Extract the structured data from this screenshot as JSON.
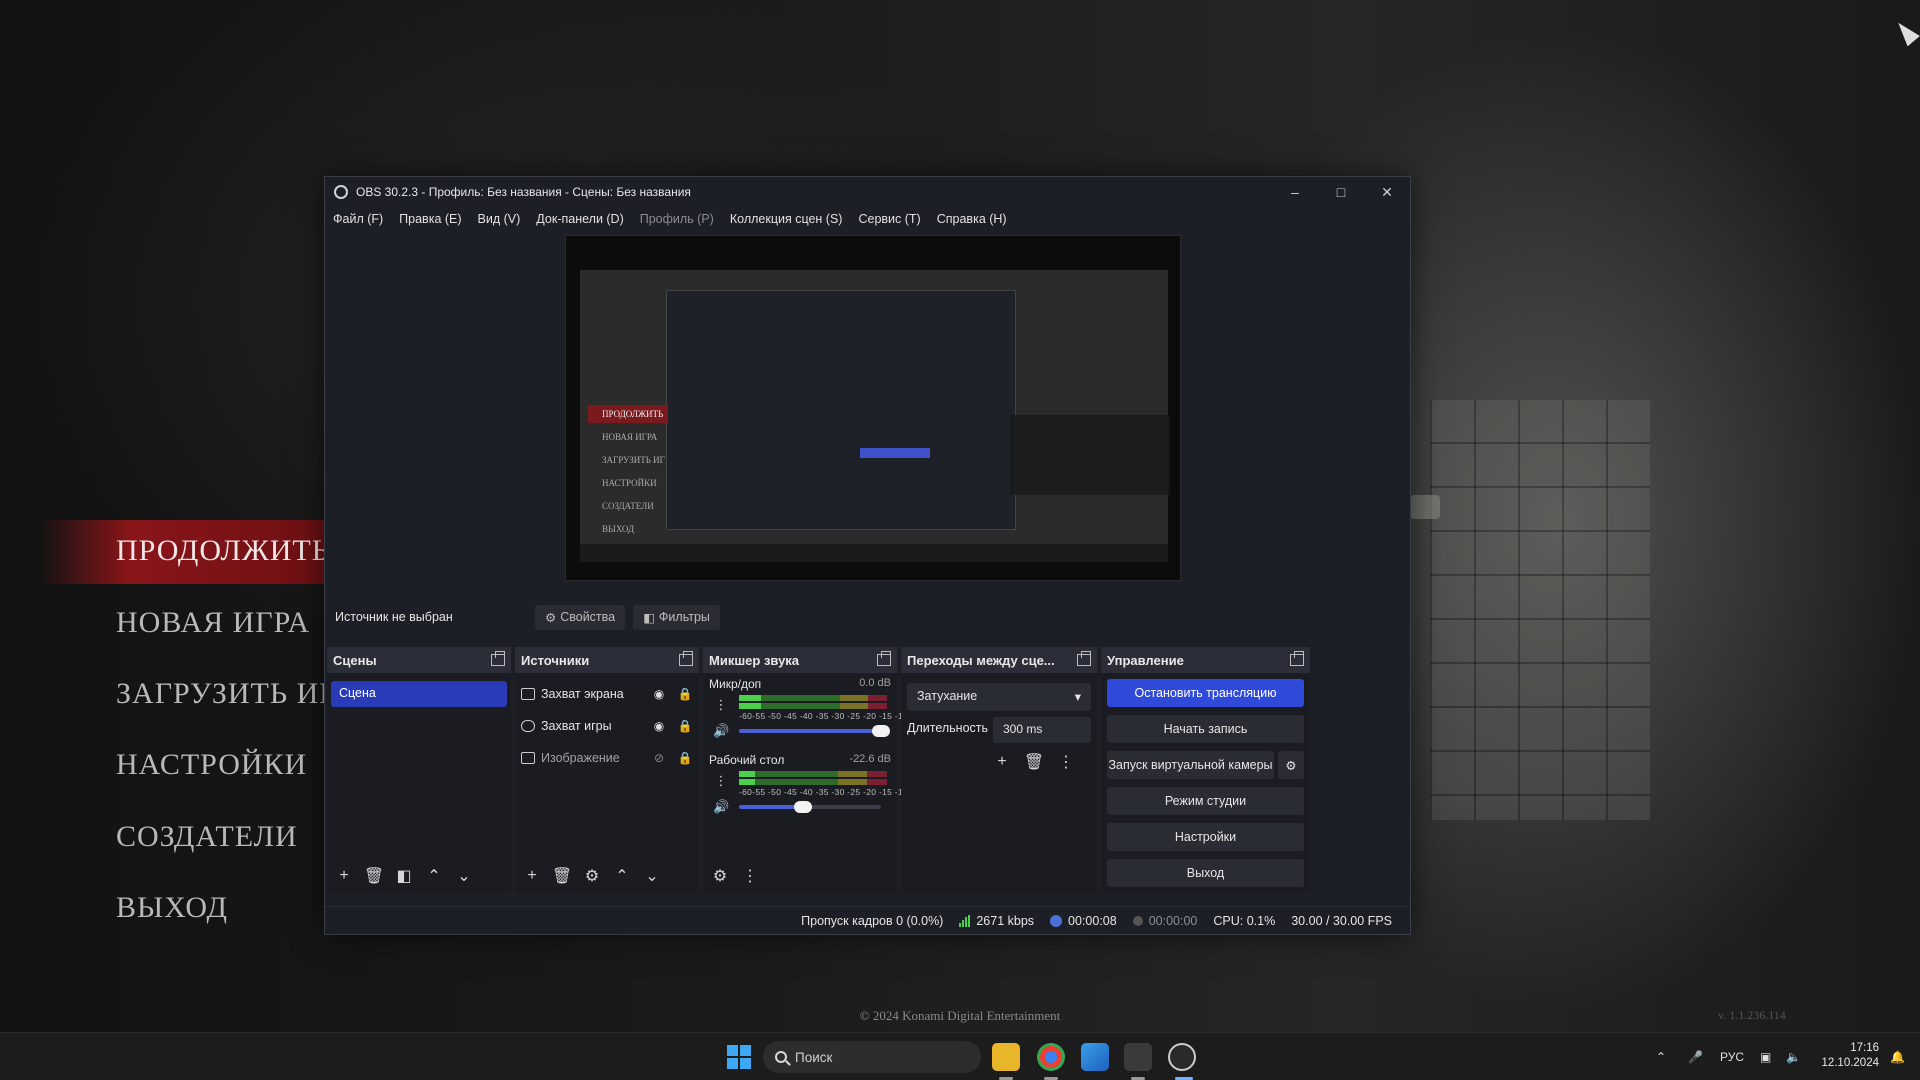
{
  "game": {
    "menu": [
      "ПРОДОЛЖИТЬ",
      "НОВАЯ ИГРА",
      "ЗАГРУЗИТЬ ИГРУ",
      "НАСТРОЙКИ",
      "СОЗДАТЕЛИ",
      "ВЫХОД"
    ],
    "copyright": "© 2024 Konami Digital Entertainment",
    "version": "v. 1.1.236.114"
  },
  "obs": {
    "title": "OBS 30.2.3 - Профиль: Без названия - Сцены: Без названия",
    "menu": [
      {
        "label": "Файл (F)",
        "disabled": false
      },
      {
        "label": "Правка (E)",
        "disabled": false
      },
      {
        "label": "Вид (V)",
        "disabled": false
      },
      {
        "label": "Док-панели (D)",
        "disabled": false
      },
      {
        "label": "Профиль (P)",
        "disabled": true
      },
      {
        "label": "Коллекция сцен (S)",
        "disabled": false
      },
      {
        "label": "Сервис (T)",
        "disabled": false
      },
      {
        "label": "Справка (H)",
        "disabled": false
      }
    ],
    "source_bar": {
      "no_source": "Источник не выбран",
      "properties": "Свойства",
      "filters": "Фильтры"
    },
    "preview_text": {
      "continue": "ПРОДОЛЖИТЬ",
      "new_game": "НОВАЯ ИГРА",
      "load": "ЗАГРУЗИТЬ ИГ",
      "settings": "НАСТРОЙКИ",
      "credits": "СОЗДАТЕЛИ",
      "exit": "ВЫХОД"
    },
    "scenes": {
      "title": "Сцены",
      "items": [
        "Сцена"
      ]
    },
    "sources": {
      "title": "Источники",
      "items": [
        {
          "label": "Захват экрана",
          "icon": "monitor-icon",
          "visible": true
        },
        {
          "label": "Захват игры",
          "icon": "gamepad-icon",
          "visible": true
        },
        {
          "label": "Изображение",
          "icon": "image-icon",
          "visible": false
        }
      ]
    },
    "mixer": {
      "title": "Микшер звука",
      "scale": "-60-55 -50 -45 -40 -35 -30 -25 -20 -15 -10 -5 0",
      "channels": [
        {
          "name": "Микр/доп",
          "db": "0.0 dB",
          "volume_fraction": 1.0,
          "level_fraction": 0.17
        },
        {
          "name": "Рабочий стол",
          "db": "-22.6 dB",
          "volume_fraction": 0.45,
          "level_fraction": 0.12
        }
      ]
    },
    "transitions": {
      "title": "Переходы между сце...",
      "selected": "Затухание",
      "duration_label": "Длительность",
      "duration_value": "300 ms"
    },
    "controls": {
      "title": "Управление",
      "stop_stream": "Остановить трансляцию",
      "start_record": "Начать запись",
      "virtual_cam": "Запуск виртуальной камеры",
      "studio_mode": "Режим студии",
      "settings": "Настройки",
      "exit": "Выход"
    },
    "status": {
      "dropped_frames": "Пропуск кадров 0 (0.0%)",
      "bitrate": "2671 kbps",
      "stream_time": "00:00:08",
      "record_time": "00:00:00",
      "cpu": "CPU: 0.1%",
      "fps": "30.00 / 30.00 FPS"
    }
  },
  "taskbar": {
    "search_placeholder": "Поиск",
    "lang": "РУС",
    "time": "17:16",
    "date": "12.10.2024"
  }
}
